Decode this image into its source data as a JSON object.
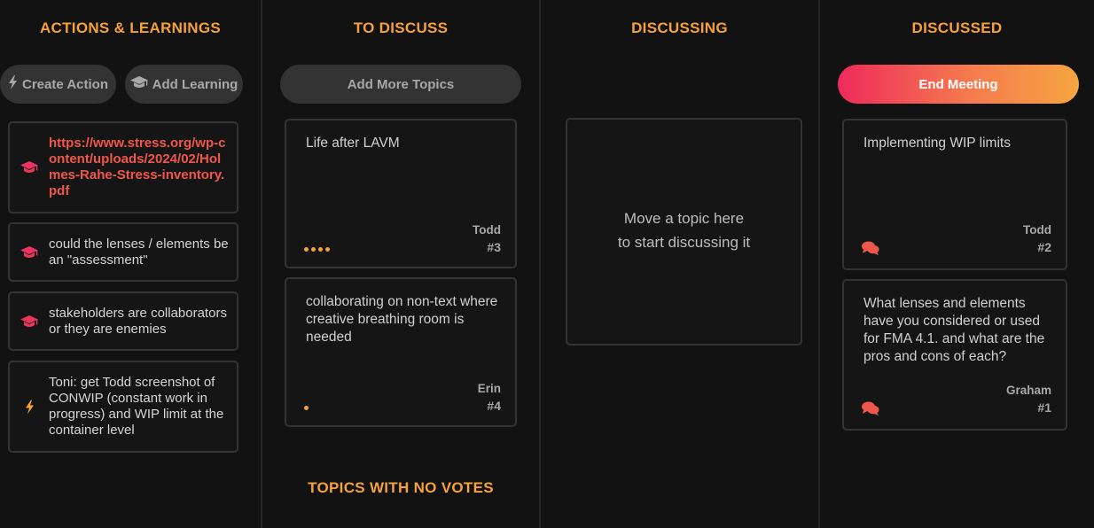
{
  "columns": {
    "actions": {
      "title": "ACTIONS & LEARNINGS",
      "create_action_label": "Create Action",
      "add_learning_label": "Add Learning",
      "items": [
        {
          "type": "learning",
          "text": "https://www.stress.org/wp-content/uploads/2024/02/Holmes-Rahe-Stress-inventory.pdf",
          "is_link": true
        },
        {
          "type": "learning",
          "text": "could the lenses / elements be an \"assessment\""
        },
        {
          "type": "learning",
          "text": "stakeholders are collaborators or they are enemies"
        },
        {
          "type": "action",
          "text": "Toni: get Todd screenshot of CONWIP (constant work in progress) and WIP limit at the container level"
        }
      ]
    },
    "to_discuss": {
      "title": "TO DISCUSS",
      "add_more_label": "Add More Topics",
      "topics": [
        {
          "text": "Life after LAVM",
          "author": "Todd",
          "number": "#3",
          "votes": 4
        },
        {
          "text": "collaborating on non-text where creative breathing room is needed",
          "author": "Erin",
          "number": "#4",
          "votes": 1
        }
      ],
      "no_votes_title": "TOPICS WITH NO VOTES"
    },
    "discussing": {
      "title": "DISCUSSING",
      "placeholder_line1": "Move a topic here",
      "placeholder_line2": "to start discussing it"
    },
    "discussed": {
      "title": "DISCUSSED",
      "end_meeting_label": "End Meeting",
      "topics": [
        {
          "text": "Implementing WIP limits",
          "author": "Todd",
          "number": "#2"
        },
        {
          "text": "What lenses and elements have you considered or used for FMA 4.1. and what are the pros and cons of each?",
          "author": "Graham",
          "number": "#1"
        }
      ]
    }
  },
  "colors": {
    "heading": "#f5a13c",
    "learning_icon": "#e8365d",
    "action_icon": "#f5a13c",
    "link": "#f0574b",
    "comment_icon": "#f0574b",
    "vote_dot": "#f5a13c"
  },
  "icons": {
    "action": "lightning-icon",
    "learning": "graduation-cap-icon",
    "comment": "comments-icon"
  }
}
